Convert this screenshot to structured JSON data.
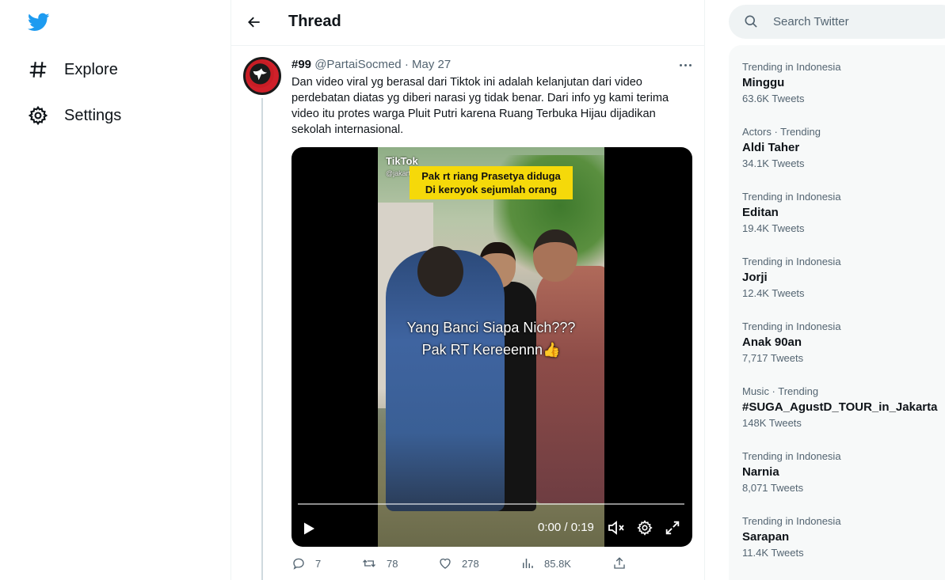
{
  "nav": {
    "items": [
      {
        "label": "Explore",
        "icon": "hashtag-icon"
      },
      {
        "label": "Settings",
        "icon": "gear-icon"
      }
    ]
  },
  "header": {
    "title": "Thread"
  },
  "tweet": {
    "display_name": "#99",
    "handle": "@PartaiSocmed",
    "separator": "·",
    "date": "May 27",
    "text": "Dan video viral yg berasal dari Tiktok ini adalah kelanjutan dari video perdebatan diatas yg diberi narasi yg tidak benar. Dari info yg kami terima video itu protes warga Pluit Putri karena Ruang Terbuka Hijau dijadikan sekolah internasional.",
    "video": {
      "watermark": "TikTok",
      "watermark_sub": "@jakarta",
      "banner_line1": "Pak rt riang Prasetya diduga",
      "banner_line2": "Di keroyok sejumlah orang",
      "caption_line1": "Yang Banci Siapa Nich???",
      "caption_line2": "Pak RT Kereeennn👍",
      "time": "0:00 / 0:19",
      "progress": 0
    },
    "actions": {
      "replies": "7",
      "retweets": "78",
      "likes": "278",
      "views": "85.8K"
    }
  },
  "search": {
    "placeholder": "Search Twitter"
  },
  "trends": [
    {
      "context": "Trending in Indonesia",
      "name": "Minggu",
      "count": "63.6K Tweets"
    },
    {
      "context": "Actors · Trending",
      "name": "Aldi Taher",
      "count": "34.1K Tweets"
    },
    {
      "context": "Trending in Indonesia",
      "name": "Editan",
      "count": "19.4K Tweets"
    },
    {
      "context": "Trending in Indonesia",
      "name": "Jorji",
      "count": "12.4K Tweets"
    },
    {
      "context": "Trending in Indonesia",
      "name": "Anak 90an",
      "count": "7,717 Tweets"
    },
    {
      "context": "Music · Trending",
      "name": "#SUGA_AgustD_TOUR_in_Jakarta",
      "count": "148K Tweets"
    },
    {
      "context": "Trending in Indonesia",
      "name": "Narnia",
      "count": "8,071 Tweets"
    },
    {
      "context": "Trending in Indonesia",
      "name": "Sarapan",
      "count": "11.4K Tweets"
    }
  ],
  "colors": {
    "brand": "#1d9bf0",
    "text": "#0f1419",
    "muted": "#536471",
    "banner": "#f5d90a"
  }
}
